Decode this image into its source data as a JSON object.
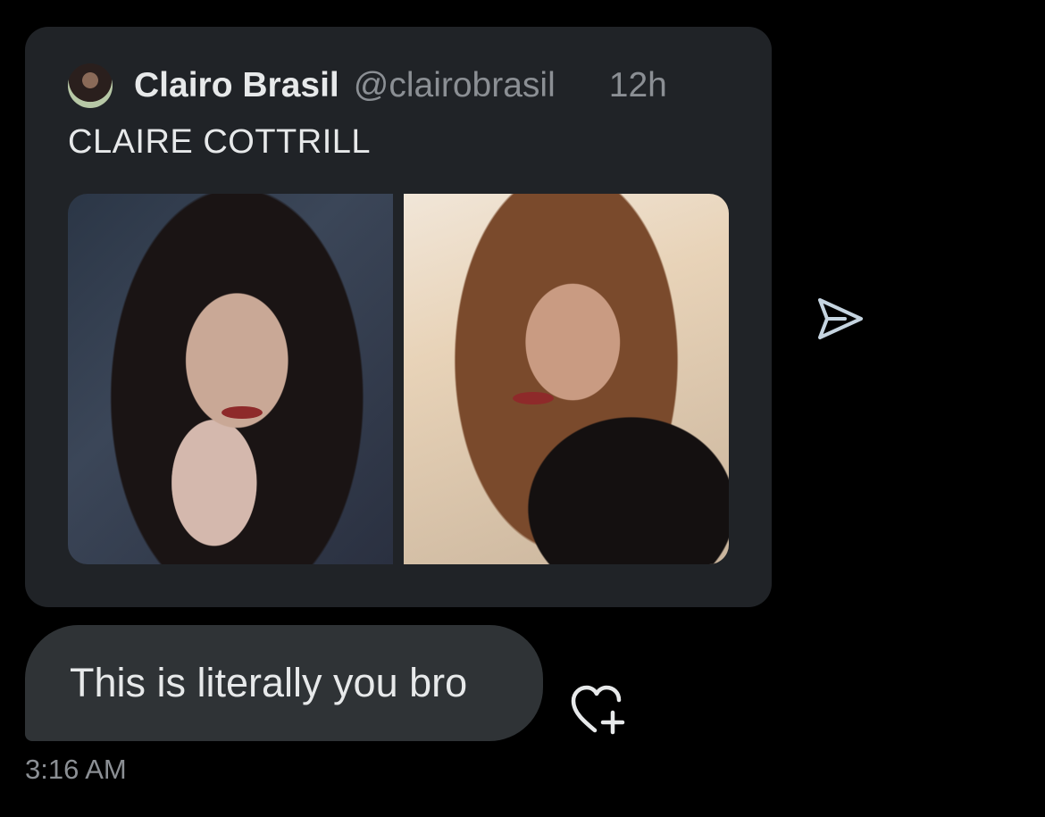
{
  "quoted_tweet": {
    "author_name": "Clairo Brasil",
    "author_handle": "@clairobrasil",
    "time_ago": "12h",
    "text": "CLAIRE COTTRILL",
    "media_count": 2
  },
  "message": {
    "text": "This is literally you bro",
    "timestamp": "3:16 AM"
  },
  "icons": {
    "share": "send-arrow-icon",
    "react": "heart-plus-icon"
  },
  "colors": {
    "background": "#000000",
    "card": "#202327",
    "bubble": "#2f3336",
    "primary_text": "#e7e9ea",
    "secondary_text": "#8b8f94",
    "icon": "#c5d4e0"
  }
}
